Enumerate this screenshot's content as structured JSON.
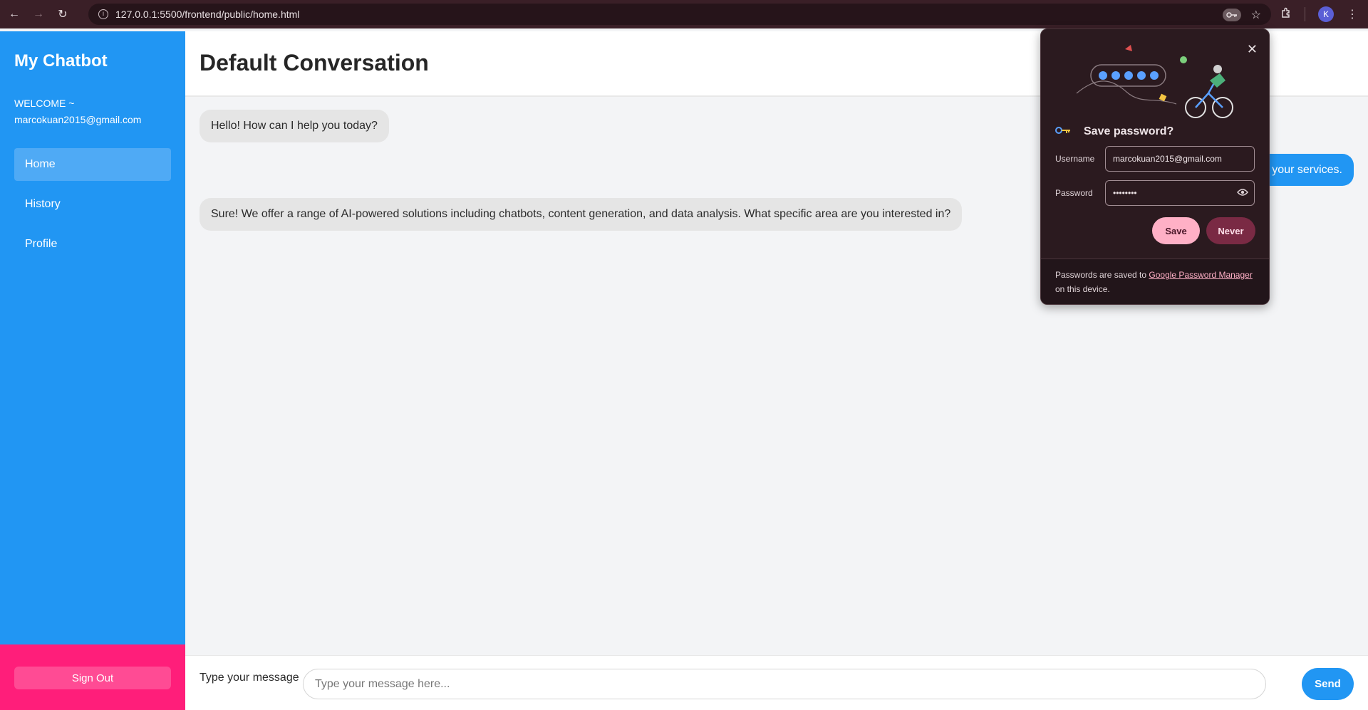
{
  "browser": {
    "url": "127.0.0.1:5500/frontend/public/home.html",
    "avatar_letter": "K"
  },
  "sidebar": {
    "title": "My Chatbot",
    "welcome": "WELCOME ~",
    "email": "marcokuan2015@gmail.com",
    "items": [
      {
        "label": "Home",
        "active": true
      },
      {
        "label": "History",
        "active": false
      },
      {
        "label": "Profile",
        "active": false
      }
    ],
    "signout_label": "Sign Out"
  },
  "main": {
    "title": "Default Conversation",
    "messages": [
      {
        "role": "bot",
        "text": "Hello! How can I help you today?"
      },
      {
        "role": "user",
        "text": "t your services."
      },
      {
        "role": "bot",
        "text": "Sure! We offer a range of AI-powered solutions including chatbots, content generation, and data analysis. What specific area are you interested in?"
      }
    ],
    "input_label": "Type your message",
    "input_placeholder": "Type your message here...",
    "send_label": "Send"
  },
  "password_popup": {
    "title": "Save password?",
    "username_label": "Username",
    "username_value": "marcokuan2015@gmail.com",
    "password_label": "Password",
    "password_value": "••••••••",
    "save_label": "Save",
    "never_label": "Never",
    "footer_prefix": "Passwords are saved to ",
    "footer_link": "Google Password Manager",
    "footer_suffix": "on this device."
  },
  "colors": {
    "sidebar": "#2196f3",
    "signout_area": "#ff1e7a",
    "accent": "#2196f3"
  }
}
